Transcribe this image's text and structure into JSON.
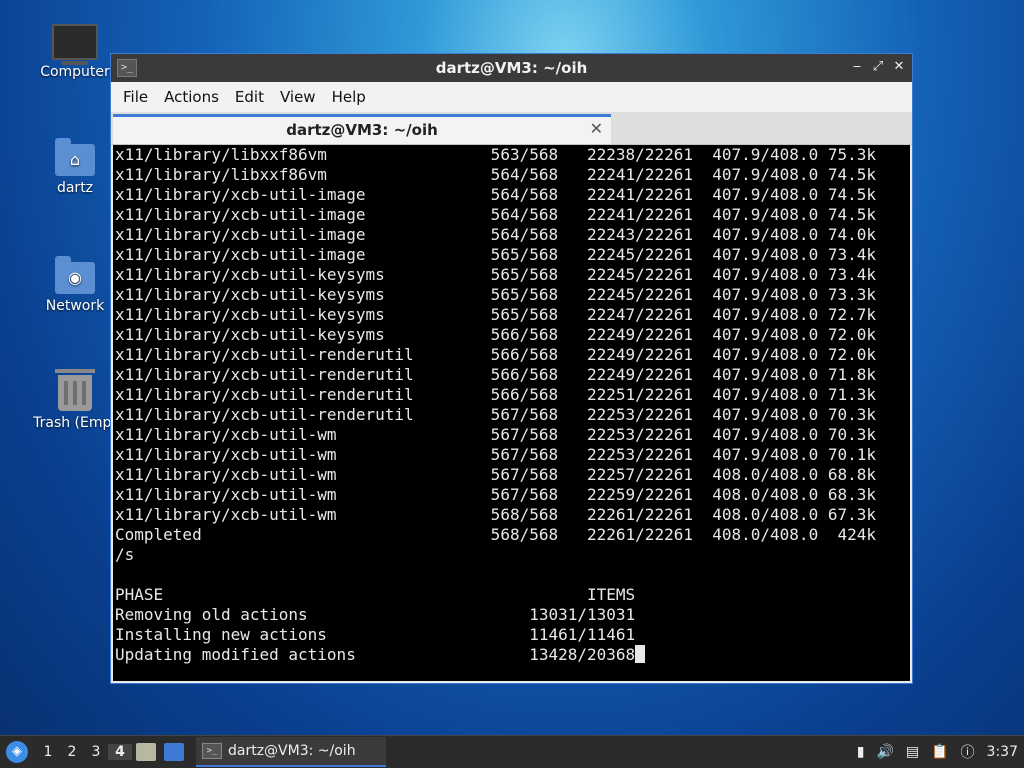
{
  "desktop": {
    "icons": [
      {
        "label": "Computer"
      },
      {
        "label": "dartz"
      },
      {
        "label": "Network"
      },
      {
        "label": "Trash (Empt"
      }
    ]
  },
  "window": {
    "title": "dartz@VM3: ~/oih",
    "app_icon": ">_",
    "controls": {
      "minimize": "‒",
      "maximize": "⤢",
      "close": "✕"
    },
    "menu": [
      "File",
      "Actions",
      "Edit",
      "View",
      "Help"
    ],
    "tab": {
      "label": "dartz@VM3: ~/oih",
      "close": "✕"
    }
  },
  "terminal": {
    "lines": [
      "x11/library/libxxf86vm                 563/568   22238/22261  407.9/408.0 75.3k",
      "x11/library/libxxf86vm                 564/568   22241/22261  407.9/408.0 74.5k",
      "x11/library/xcb-util-image             564/568   22241/22261  407.9/408.0 74.5k",
      "x11/library/xcb-util-image             564/568   22241/22261  407.9/408.0 74.5k",
      "x11/library/xcb-util-image             564/568   22243/22261  407.9/408.0 74.0k",
      "x11/library/xcb-util-image             565/568   22245/22261  407.9/408.0 73.4k",
      "x11/library/xcb-util-keysyms           565/568   22245/22261  407.9/408.0 73.4k",
      "x11/library/xcb-util-keysyms           565/568   22245/22261  407.9/408.0 73.3k",
      "x11/library/xcb-util-keysyms           565/568   22247/22261  407.9/408.0 72.7k",
      "x11/library/xcb-util-keysyms           566/568   22249/22261  407.9/408.0 72.0k",
      "x11/library/xcb-util-renderutil        566/568   22249/22261  407.9/408.0 72.0k",
      "x11/library/xcb-util-renderutil        566/568   22249/22261  407.9/408.0 71.8k",
      "x11/library/xcb-util-renderutil        566/568   22251/22261  407.9/408.0 71.3k",
      "x11/library/xcb-util-renderutil        567/568   22253/22261  407.9/408.0 70.3k",
      "x11/library/xcb-util-wm                567/568   22253/22261  407.9/408.0 70.3k",
      "x11/library/xcb-util-wm                567/568   22253/22261  407.9/408.0 70.1k",
      "x11/library/xcb-util-wm                567/568   22257/22261  408.0/408.0 68.8k",
      "x11/library/xcb-util-wm                567/568   22259/22261  408.0/408.0 68.3k",
      "x11/library/xcb-util-wm                568/568   22261/22261  408.0/408.0 67.3k",
      "Completed                              568/568   22261/22261  408.0/408.0  424k",
      "/s",
      "",
      "PHASE                                            ITEMS",
      "Removing old actions                       13031/13031",
      "Installing new actions                     11461/11461"
    ],
    "last_line": "Updating modified actions                  13428/20368"
  },
  "taskbar": {
    "start_icon": "◈",
    "workspaces": [
      "1",
      "2",
      "3",
      "4"
    ],
    "active_workspace": "4",
    "task_label": "dartz@VM3: ~/oih",
    "task_icon": ">_",
    "clock": "3:37",
    "tray_icons": [
      "battery-icon",
      "volume-icon",
      "network-icon",
      "clipboard-icon",
      "notification-icon"
    ]
  }
}
